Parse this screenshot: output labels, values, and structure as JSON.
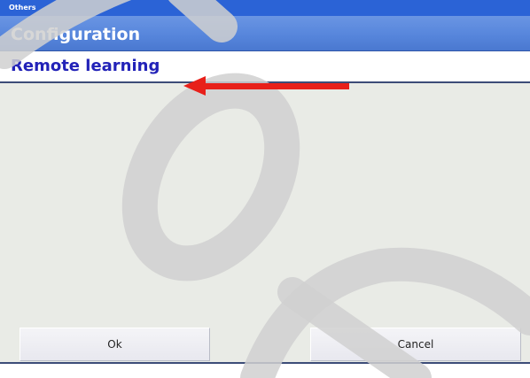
{
  "window": {
    "title": "Others"
  },
  "header": {
    "title": "Configuration"
  },
  "subheader": {
    "title": "Remote learning"
  },
  "buttons": {
    "ok_label": "Ok",
    "cancel_label": "Cancel"
  },
  "colors": {
    "titlebar": "#2b63d6",
    "header": "#5786dc",
    "subheader_text": "#2222b8",
    "content_bg": "#e9ebe6",
    "annotation_arrow": "#e8201a",
    "watermark": "#d4d4d4"
  },
  "annotation": {
    "icon": "left-arrow-icon"
  }
}
